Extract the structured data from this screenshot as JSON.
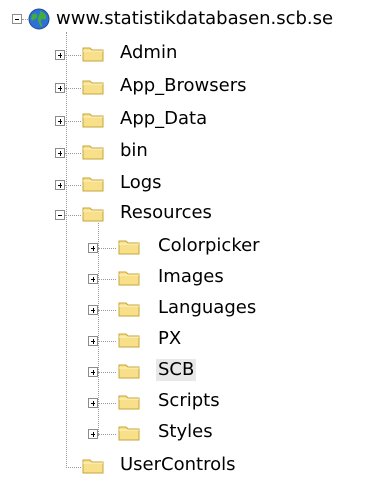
{
  "tree": {
    "root": {
      "label": "www.statistikdatabasen.scb.se",
      "icon": "globe-icon",
      "expanded": true
    },
    "level1": [
      {
        "label": "Admin",
        "icon": "folder-icon",
        "expanded": false
      },
      {
        "label": "App_Browsers",
        "icon": "folder-icon",
        "expanded": false
      },
      {
        "label": "App_Data",
        "icon": "folder-icon",
        "expanded": false
      },
      {
        "label": "bin",
        "icon": "folder-icon",
        "expanded": false
      },
      {
        "label": "Logs",
        "icon": "folder-icon",
        "expanded": false
      },
      {
        "label": "Resources",
        "icon": "folder-icon",
        "expanded": true
      },
      {
        "label": "UserControls",
        "icon": "folder-icon",
        "expanded": false
      }
    ],
    "resources_children": [
      {
        "label": "Colorpicker",
        "icon": "folder-icon",
        "expanded": false
      },
      {
        "label": "Images",
        "icon": "folder-icon",
        "expanded": false
      },
      {
        "label": "Languages",
        "icon": "folder-icon",
        "expanded": false
      },
      {
        "label": "PX",
        "icon": "folder-icon",
        "expanded": false
      },
      {
        "label": "SCB",
        "icon": "folder-icon",
        "expanded": false,
        "selected": true
      },
      {
        "label": "Scripts",
        "icon": "folder-icon",
        "expanded": false
      },
      {
        "label": "Styles",
        "icon": "folder-icon",
        "expanded": false
      }
    ]
  },
  "colors": {
    "folder_fill": "#f8e08a",
    "folder_stroke": "#c8a53a",
    "tree_line": "#9a9a9a",
    "selected_bg": "#e8e8e8"
  }
}
